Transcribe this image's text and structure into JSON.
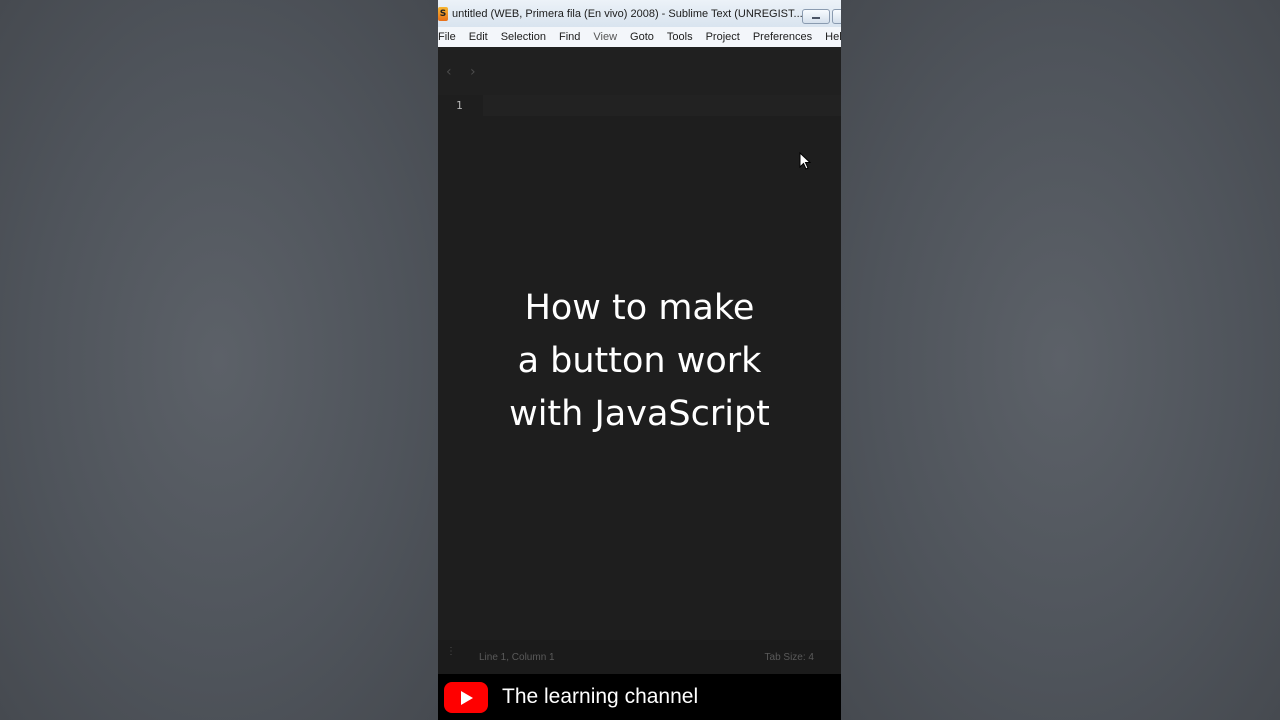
{
  "window": {
    "app_icon": "S",
    "title": "untitled (WEB, Primera fila (En vivo) 2008) - Sublime Text (UNREGIST..."
  },
  "menu": [
    {
      "label": "File"
    },
    {
      "label": "Edit"
    },
    {
      "label": "Selection"
    },
    {
      "label": "Find"
    },
    {
      "label": "View"
    },
    {
      "label": "Goto"
    },
    {
      "label": "Tools"
    },
    {
      "label": "Project"
    },
    {
      "label": "Preferences"
    },
    {
      "label": "Hel"
    }
  ],
  "tabstrip": {
    "back_icon": "chevron-left-icon",
    "forward_icon": "chevron-right-icon"
  },
  "editor": {
    "line_number": "1"
  },
  "overlay": {
    "line1": "How to make",
    "line2": "a button work",
    "line3": "with JavaScript"
  },
  "statusbar": {
    "position": "Line 1, Column 1",
    "tab_size": "Tab Size: 4"
  },
  "channel": {
    "logo_icon": "youtube-logo-icon",
    "name": "The learning channel"
  },
  "colors": {
    "editor_bg": "#1e1e1e",
    "youtube_red": "#ff0000"
  }
}
